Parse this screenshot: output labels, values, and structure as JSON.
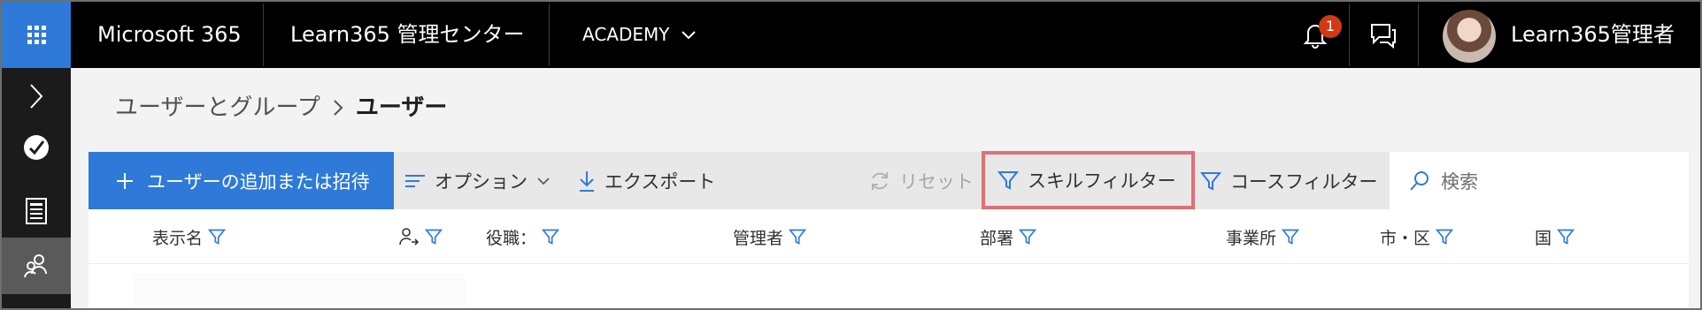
{
  "topbar": {
    "brand": "Microsoft 365",
    "app_title": "Learn365 管理センター",
    "tenant": "ACADEMY",
    "notification_count": "1",
    "user_name": "Learn365管理者",
    "icons": [
      "waffle-icon",
      "chevron-down-icon",
      "bell-icon",
      "feedback-icon"
    ]
  },
  "rail": {
    "icons": [
      "chevron-right-icon",
      "check-circle-icon",
      "document-list-icon",
      "people-icon"
    ],
    "active_index": 3
  },
  "breadcrumb": {
    "parent": "ユーザーとグループ",
    "current": "ユーザー"
  },
  "commands": {
    "add_invite": "ユーザーの追加または招待",
    "options": "オプション",
    "export": "エクスポート",
    "reset": "リセット",
    "skill_filter": "スキルフィルター",
    "course_filter": "コースフィルター",
    "search_placeholder": "検索"
  },
  "columns": {
    "display_name": "表示名",
    "role": "役職：",
    "manager": "管理者",
    "department": "部署",
    "office": "事業所",
    "city": "市・区",
    "country": "国"
  },
  "colors": {
    "accent": "#2f7ad8",
    "topbar": "#000000",
    "rail": "#1b1b1b",
    "highlight_border": "#e07074",
    "notification_badge": "#d13a12"
  }
}
